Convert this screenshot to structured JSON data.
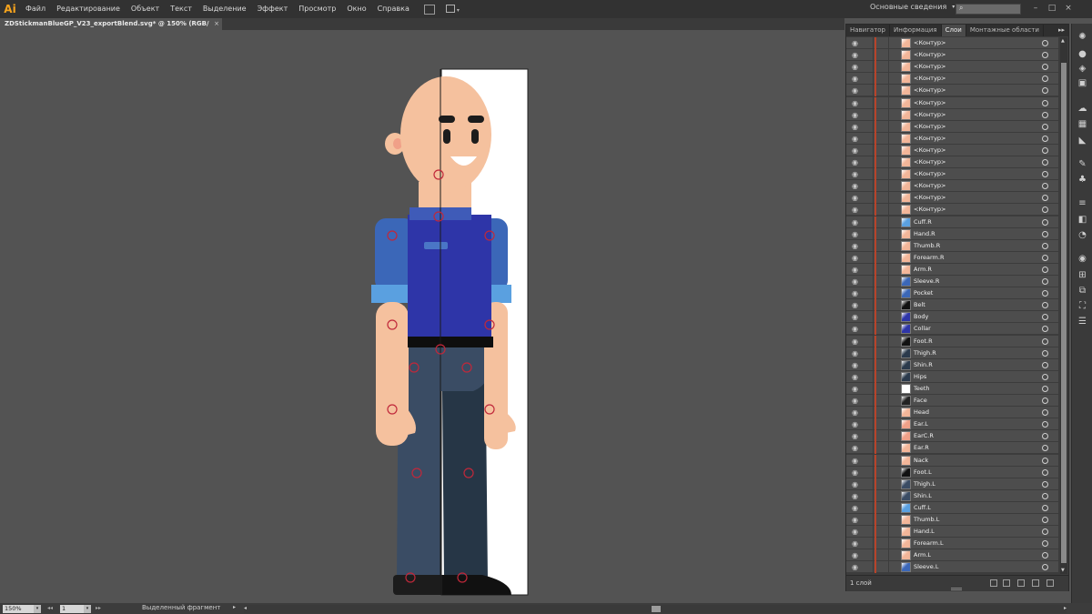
{
  "app": {
    "logo": "Ai",
    "menu": [
      "Файл",
      "Редактирование",
      "Объект",
      "Текст",
      "Выделение",
      "Эффект",
      "Просмотр",
      "Окно",
      "Справка"
    ],
    "workspace": "Основные сведения",
    "search_icon": "search-icon"
  },
  "document": {
    "tab_title": "ZDStickmanBlueGP_V23_exportBlend.svg* @ 150% (RGB/Просмотр)",
    "close": "×"
  },
  "status": {
    "zoom": "150%",
    "artboard": "1",
    "selection_tool": "Выделенный фрагмент"
  },
  "panel": {
    "tabs": [
      "Навигатор",
      "Информация",
      "Слои",
      "Монтажные области"
    ],
    "active_tab": "Слои",
    "menu_glyph": "▸▸",
    "layer_count": "1 слой",
    "layers": [
      {
        "name": "<Контур>",
        "thumb": "#f3b699"
      },
      {
        "name": "<Контур>",
        "thumb": "#f3b699"
      },
      {
        "name": "<Контур>",
        "thumb": "#f3b699"
      },
      {
        "name": "<Контур>",
        "thumb": "#f3b699"
      },
      {
        "name": "<Контур>",
        "thumb": "#f3b699"
      },
      {
        "name": "<Контур>",
        "thumb": "#f3b699"
      },
      {
        "name": "<Контур>",
        "thumb": "#f3b699"
      },
      {
        "name": "<Контур>",
        "thumb": "#f3b699"
      },
      {
        "name": "<Контур>",
        "thumb": "#f3b699"
      },
      {
        "name": "<Контур>",
        "thumb": "#f3b699"
      },
      {
        "name": "<Контур>",
        "thumb": "#f3b699"
      },
      {
        "name": "<Контур>",
        "thumb": "#f3b699"
      },
      {
        "name": "<Контур>",
        "thumb": "#f3b699"
      },
      {
        "name": "<Контур>",
        "thumb": "#f3b699"
      },
      {
        "name": "<Контур>",
        "thumb": "#f3b699"
      },
      {
        "name": "Cuff.R",
        "thumb": "#5aa0e0"
      },
      {
        "name": "Hand.R",
        "thumb": "#f3b699"
      },
      {
        "name": "Thumb.R",
        "thumb": "#f3b699"
      },
      {
        "name": "Forearm.R",
        "thumb": "#f3b699"
      },
      {
        "name": "Arm.R",
        "thumb": "#f3b699"
      },
      {
        "name": "Sleeve.R",
        "thumb": "#3b67b8"
      },
      {
        "name": "Pocket",
        "thumb": "#3b67b8"
      },
      {
        "name": "Belt",
        "thumb": "#111111"
      },
      {
        "name": "Body",
        "thumb": "#2e35a8"
      },
      {
        "name": "Collar",
        "thumb": "#2e35a8"
      },
      {
        "name": "Foot.R",
        "thumb": "#111111"
      },
      {
        "name": "Thigh.R",
        "thumb": "#2b3a4c"
      },
      {
        "name": "Shin.R",
        "thumb": "#2b3a4c"
      },
      {
        "name": "Hips",
        "thumb": "#2b3a4c"
      },
      {
        "name": "Teeth",
        "thumb": "#ffffff"
      },
      {
        "name": "Face",
        "thumb": "#222222"
      },
      {
        "name": "Head",
        "thumb": "#f3b699"
      },
      {
        "name": "Ear.L",
        "thumb": "#f0a088"
      },
      {
        "name": "EarC.R",
        "thumb": "#f0a088"
      },
      {
        "name": "Ear.R",
        "thumb": "#f3b699"
      },
      {
        "name": "Nack",
        "thumb": "#f3b699"
      },
      {
        "name": "Foot.L",
        "thumb": "#111111"
      },
      {
        "name": "Thigh.L",
        "thumb": "#3a4c64"
      },
      {
        "name": "Shin.L",
        "thumb": "#3a4c64"
      },
      {
        "name": "Cuff.L",
        "thumb": "#5aa0e0"
      },
      {
        "name": "Thumb.L",
        "thumb": "#f3b699"
      },
      {
        "name": "Hand.L",
        "thumb": "#f3b699"
      },
      {
        "name": "Forearm.L",
        "thumb": "#f3b699"
      },
      {
        "name": "Arm.L",
        "thumb": "#f3b699"
      },
      {
        "name": "Sleeve.L",
        "thumb": "#3b67b8"
      }
    ]
  },
  "colors": {
    "skin": "#f5c19e",
    "shirt": "#2e35a8",
    "sleeve": "#3b67b8",
    "cuff": "#5aa0e0",
    "pants_l": "#3a4c64",
    "pants_r": "#263646",
    "shoes": "#111111",
    "layer_color": "#b7432a",
    "ai_orange": "#f7a41d"
  }
}
